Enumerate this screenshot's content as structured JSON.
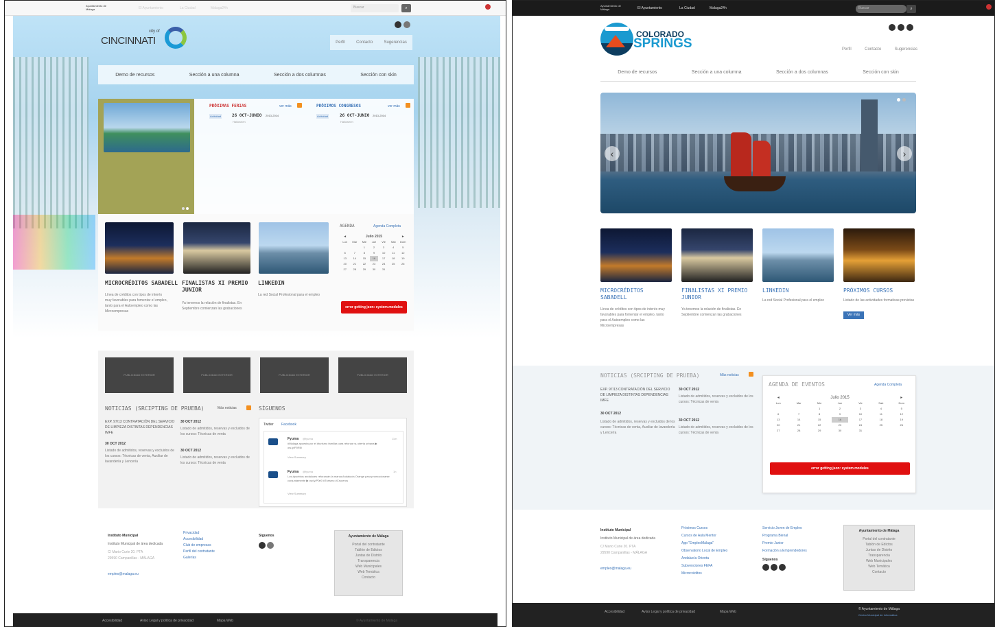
{
  "common": {
    "top_org": "Ayuntamiento de Málaga",
    "top_links": [
      "El Ayuntamiento",
      "La Ciudad",
      "Malaga24h"
    ],
    "search_placeholder": "Buscar",
    "utility_links": [
      "Perfil",
      "Contacto",
      "Sugerencias"
    ],
    "nav": [
      "Demo de recursos",
      "Sección a una columna",
      "Sección a dos columnas",
      "Sección con skin"
    ],
    "cards": [
      {
        "title": "MICROCRÉDITOS SABADELL",
        "text": "Línea de créditos con tipos de interés muy favorables para fomentar el empleo, tanto para el Autoempleo como las Microempresas"
      },
      {
        "title": "FINALISTAS XI PREMIO JUNIOR",
        "text": "Ya tenemos la relación de finalistas. En Septiembre comienzan las grabaciones"
      },
      {
        "title": "LINKEDIN",
        "text": "La red Social Profesional para el empleo"
      }
    ],
    "agenda_link": "Agenda Completa",
    "calendar": {
      "month": "Julio 2015",
      "days_head": [
        "Lun",
        "Mar",
        "Mie",
        "Jue",
        "Vie",
        "Sab",
        "Dom"
      ],
      "weeks": [
        [
          "",
          "",
          "1",
          "2",
          "3",
          "4",
          "5"
        ],
        [
          "6",
          "7",
          "8",
          "9",
          "10",
          "11",
          "12"
        ],
        [
          "13",
          "14",
          "15",
          "16",
          "17",
          "18",
          "19"
        ],
        [
          "20",
          "21",
          "22",
          "23",
          "24",
          "25",
          "26"
        ],
        [
          "27",
          "28",
          "29",
          "30",
          "31",
          "",
          ""
        ]
      ]
    },
    "error_text": "error getting json: system.modules",
    "news_title": "NOTICIAS (SRCIPTING DE PRUEBA)",
    "news_more": "Más noticias",
    "news": [
      {
        "date": "",
        "text": "EXP. 97/13 CONTRATACIÓN DEL SERVICIO DE LIMPIEZA DISTINTAS DEPENDENCIAS IMFE"
      },
      {
        "date": "30 OCT 2012",
        "text": "Listado de admitidos, reservas y excluidos de los cursos: Técnicas de venta, Auxiliar de lavandería y Lencería"
      },
      {
        "date": "30 OCT 2012",
        "text": "Listado de admitidos, reservas y excluidos de los cursos: Técnicas de venta"
      },
      {
        "date": "30 OCT 2012",
        "text": "Listado de admitidos, reservas y excluidos de los cursos: Técnicas de venta"
      }
    ],
    "footer": {
      "inst_title": "Instituto Municipal",
      "inst_text": "Instituto Municipal de área dedicada",
      "address1": "C/ Mario Curie 20. PTA",
      "address2": "29590 Campanillas - MÁLAGA",
      "email": "empleo@malaga.eu",
      "box_title": "Ayuntamiento de Málaga",
      "box_links": [
        "Portal del contratante",
        "Tablón de Edictos",
        "Juntas de Distrito",
        "Transparencia",
        "Web Municipales",
        "Web Temática",
        "Contacto"
      ],
      "siguenos": "Síguenos"
    }
  },
  "left": {
    "logo_city": "CINCINNATI",
    "logo_small": "city of",
    "ferias_title": "PRÓXIMAS FERIAS",
    "congresos_title": "PRÓXIMOS CONGRESOS",
    "ver_mas": "ver más",
    "event_tag": "Actividad",
    "event_date": "26 OCT-JUNIO",
    "event_year": "2013-2014",
    "event_sub": "Halloween",
    "agenda_title": "AGENDA",
    "ads": [
      "PUBLICIDAD EXTERIOR",
      "PUBLICIDAD EXTERIOR",
      "PUBLICIDAD EXTERIOR",
      "PUBLICIDAD EXTERIOR"
    ],
    "siguenos_title": "SÍGUENOS",
    "tabs": [
      "Twitter",
      "Facebook"
    ],
    "tweets": [
      {
        "user": "Fyuma",
        "handle": "@fyuma",
        "time": "11m",
        "text": "#Málaga apuesta por el #turismo familiar para reforzar su oferta urbana ▶ ow.ly/P0Rl0",
        "summary": "View Summary"
      },
      {
        "user": "Fyuma",
        "handle": "@fyuma",
        "time": "1h",
        "text": "Los #pueblos andaluces reforzarán la marca Andalucía Orange para promocionarse conjuntamente ▶ ow.ly/P0rl0 #Turismo #Cruceros",
        "summary": "View Summary"
      }
    ],
    "foot_links": [
      "Privacidad",
      "Accesibilidad",
      "Club de empresas",
      "Perfil del contratante",
      "Galerías"
    ],
    "bottom_links": [
      "Accesibilidad",
      "Aviso Legal y política de privacidad",
      "Mapa Web"
    ],
    "copyright": "© Ayuntamiento de Málaga"
  },
  "right": {
    "logo_top": "COLORADO",
    "logo_bottom": "SPRINGS",
    "extra_card": {
      "title": "PRÓXIMOS CURSOS",
      "text": "Listado de las actividades formativas previstas",
      "button": "Ver más"
    },
    "agenda_title": "AGENDA DE EVENTOS",
    "foot_col2": [
      "Próximos Cursos",
      "Cursos de Aula Mentor",
      "App \"EmpleoMálaga\"",
      "Observatorio Local de Empleo",
      "Andalucía Orienta",
      "Subvenciones FEFA",
      "Microcréditos"
    ],
    "foot_col3": [
      "Servicio Joven de Empleo",
      "Programa Bienal",
      "Premio Junior",
      "Formación a Emprendedores"
    ],
    "bottom_links": [
      "Accesibilidad",
      "Aviso Legal y política de privacidad",
      "Mapa Web"
    ],
    "copyright": "© Ayuntamiento de Málaga",
    "copyright_sub": "Centro Municipal de Informática"
  },
  "colors": {
    "olive": "#a3a356",
    "red": "#e01010",
    "orange": "#f39020",
    "blue": "#3a73b7",
    "cinci_blue": "#1a9ad6",
    "cinci_green": "#8cc63f"
  }
}
